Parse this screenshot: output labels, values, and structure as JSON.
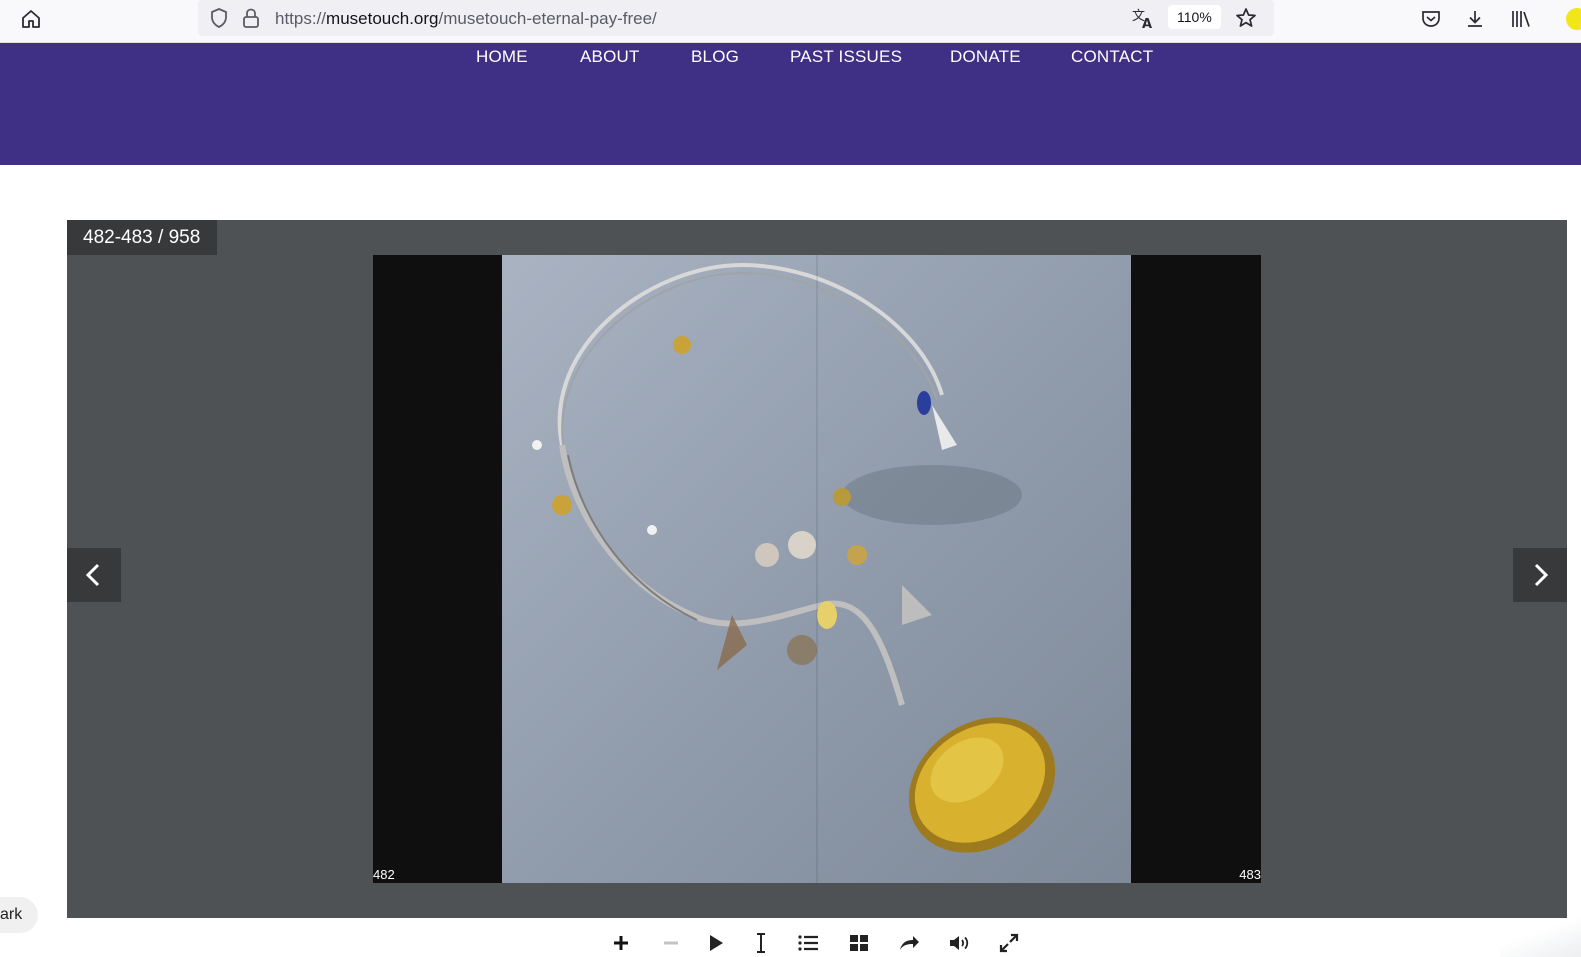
{
  "browser": {
    "url_scheme": "https://",
    "url_host": "musetouch.org",
    "url_path": "/musetouch-eternal-pay-free/",
    "zoom": "110%"
  },
  "nav": {
    "items": [
      "HOME",
      "ABOUT",
      "BLOG",
      "PAST ISSUES",
      "DONATE",
      "CONTACT"
    ]
  },
  "flipbook": {
    "page_counter": "482-483 / 958",
    "left_page_number": "482",
    "right_page_number": "483",
    "image_subject": "necklace-photo"
  },
  "bookmark_tab": {
    "label": "ark"
  },
  "colors": {
    "header": "#3f3086",
    "viewer": "#4f5255",
    "counter_bg": "#38393b"
  },
  "icons": [
    "home-icon",
    "shield-icon",
    "lock-icon",
    "translate-icon",
    "star-icon",
    "pocket-icon",
    "download-icon",
    "library-icon",
    "zoom-in-icon",
    "zoom-out-icon",
    "play-icon",
    "text-select-icon",
    "table-of-contents-icon",
    "thumbnails-icon",
    "share-icon",
    "sound-icon",
    "fullscreen-icon",
    "chevron-left-icon",
    "chevron-right-icon"
  ]
}
